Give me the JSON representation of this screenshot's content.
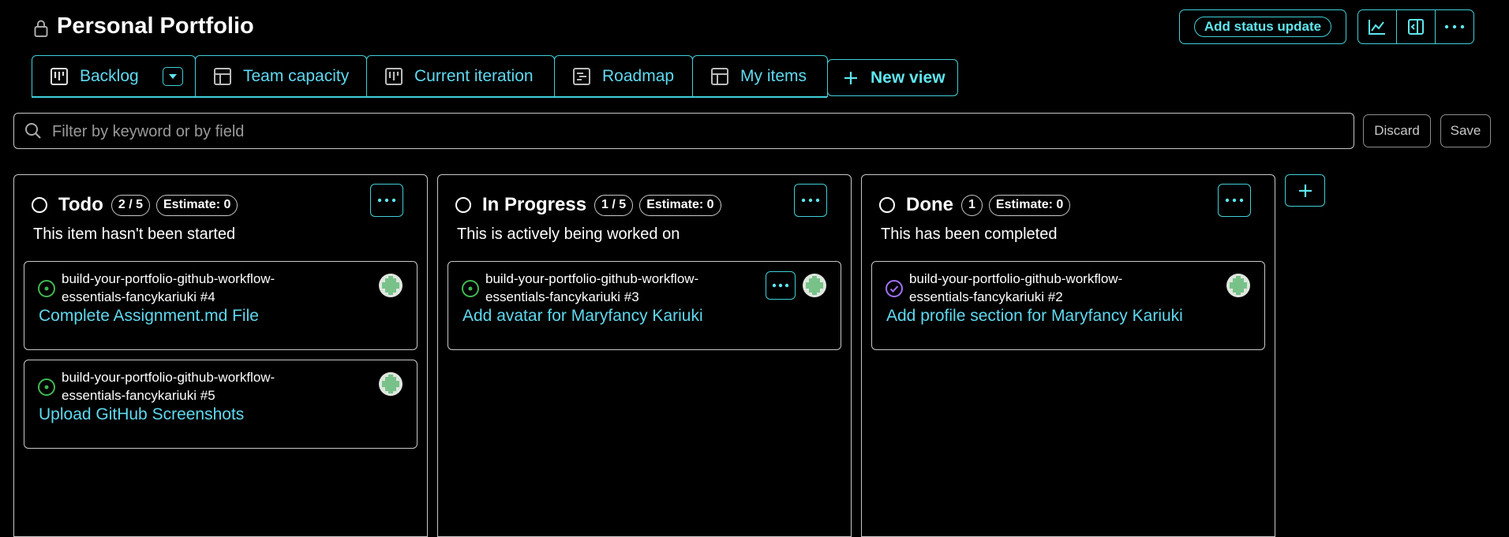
{
  "header": {
    "title": "Personal Portfolio",
    "status_button": "Add status update",
    "lock_icon": "lock-icon",
    "toolbar_icons": [
      "insights-chart-icon",
      "sidebar-panel-icon",
      "more-ellipsis-icon"
    ]
  },
  "tabs": [
    {
      "label": "Backlog",
      "icon": "board-icon",
      "active": true
    },
    {
      "label": "Team capacity",
      "icon": "table-icon"
    },
    {
      "label": "Current iteration",
      "icon": "board-icon"
    },
    {
      "label": "Roadmap",
      "icon": "roadmap-icon"
    },
    {
      "label": "My items",
      "icon": "table-icon"
    }
  ],
  "new_view": {
    "label": "New view"
  },
  "filter": {
    "placeholder": "Filter by keyword or by field",
    "discard": "Discard",
    "save": "Save"
  },
  "columns": [
    {
      "name": "Todo",
      "count": "2 / 5",
      "estimate": "Estimate: 0",
      "description": "This item hasn't been started",
      "cards": [
        {
          "repo": "build-your-portfolio-github-workflow-essentials-fancykariuki #4",
          "title": "Complete Assignment.md File",
          "status": "open"
        },
        {
          "repo": "build-your-portfolio-github-workflow-essentials-fancykariuki #5",
          "title": "Upload GitHub Screenshots",
          "status": "open"
        }
      ]
    },
    {
      "name": "In Progress",
      "count": "1 / 5",
      "estimate": "Estimate: 0",
      "description": "This is actively being worked on",
      "cards": [
        {
          "repo": "build-your-portfolio-github-workflow-essentials-fancykariuki #3",
          "title": "Add avatar for Maryfancy Kariuki",
          "status": "open"
        }
      ]
    },
    {
      "name": "Done",
      "count": "1",
      "estimate": "Estimate: 0",
      "description": "This has been completed",
      "cards": [
        {
          "repo": "build-your-portfolio-github-workflow-essentials-fancykariuki #2",
          "title": "Add profile section for Maryfancy Kariuki",
          "status": "closed"
        }
      ]
    }
  ],
  "colors": {
    "accent": "#3fd0d8",
    "link": "#5fd9f0",
    "open": "#3fb950",
    "closed": "#a371f7",
    "border": "#c8c8c8",
    "background": "#000000"
  }
}
